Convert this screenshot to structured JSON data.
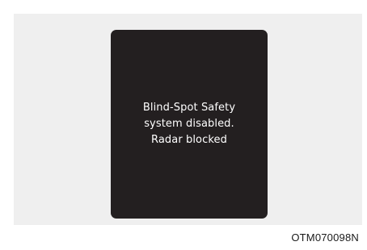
{
  "display": {
    "message_lines": [
      "Blind-Spot Safety",
      "system disabled.",
      "Radar blocked"
    ]
  },
  "figure": {
    "code": "OTM070098N"
  },
  "colors": {
    "screen_background": "#231f20",
    "panel_background": "#efefef",
    "text": "#ffffff"
  }
}
